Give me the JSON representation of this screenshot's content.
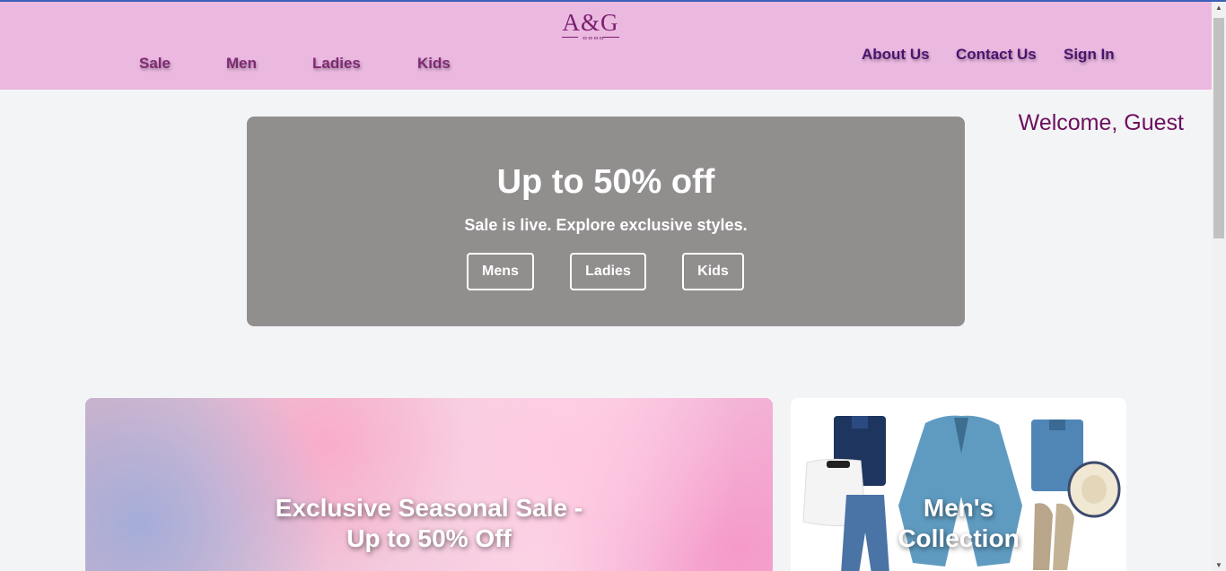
{
  "brand": {
    "logo_text": "A&G",
    "logo_mark": "ⴰⴰⴰⴰ"
  },
  "nav": {
    "left": [
      "Sale",
      "Men",
      "Ladies",
      "Kids"
    ],
    "right": [
      "About Us",
      "Contact Us",
      "Sign In"
    ]
  },
  "welcome": "Welcome, Guest",
  "hero": {
    "title": "Up to 50% off",
    "subtitle": "Sale is live. Explore exclusive styles.",
    "buttons": [
      "Mens",
      "Ladies",
      "Kids"
    ]
  },
  "cards": {
    "sale": {
      "line1": "Exclusive Seasonal Sale -",
      "line2": "Up to 50% Off"
    },
    "men": {
      "line1": "Men's",
      "line2": "Collection"
    }
  },
  "colors": {
    "header": "#ebb8e0",
    "hero": "#918e8e",
    "accent": "#6d0e5e"
  }
}
